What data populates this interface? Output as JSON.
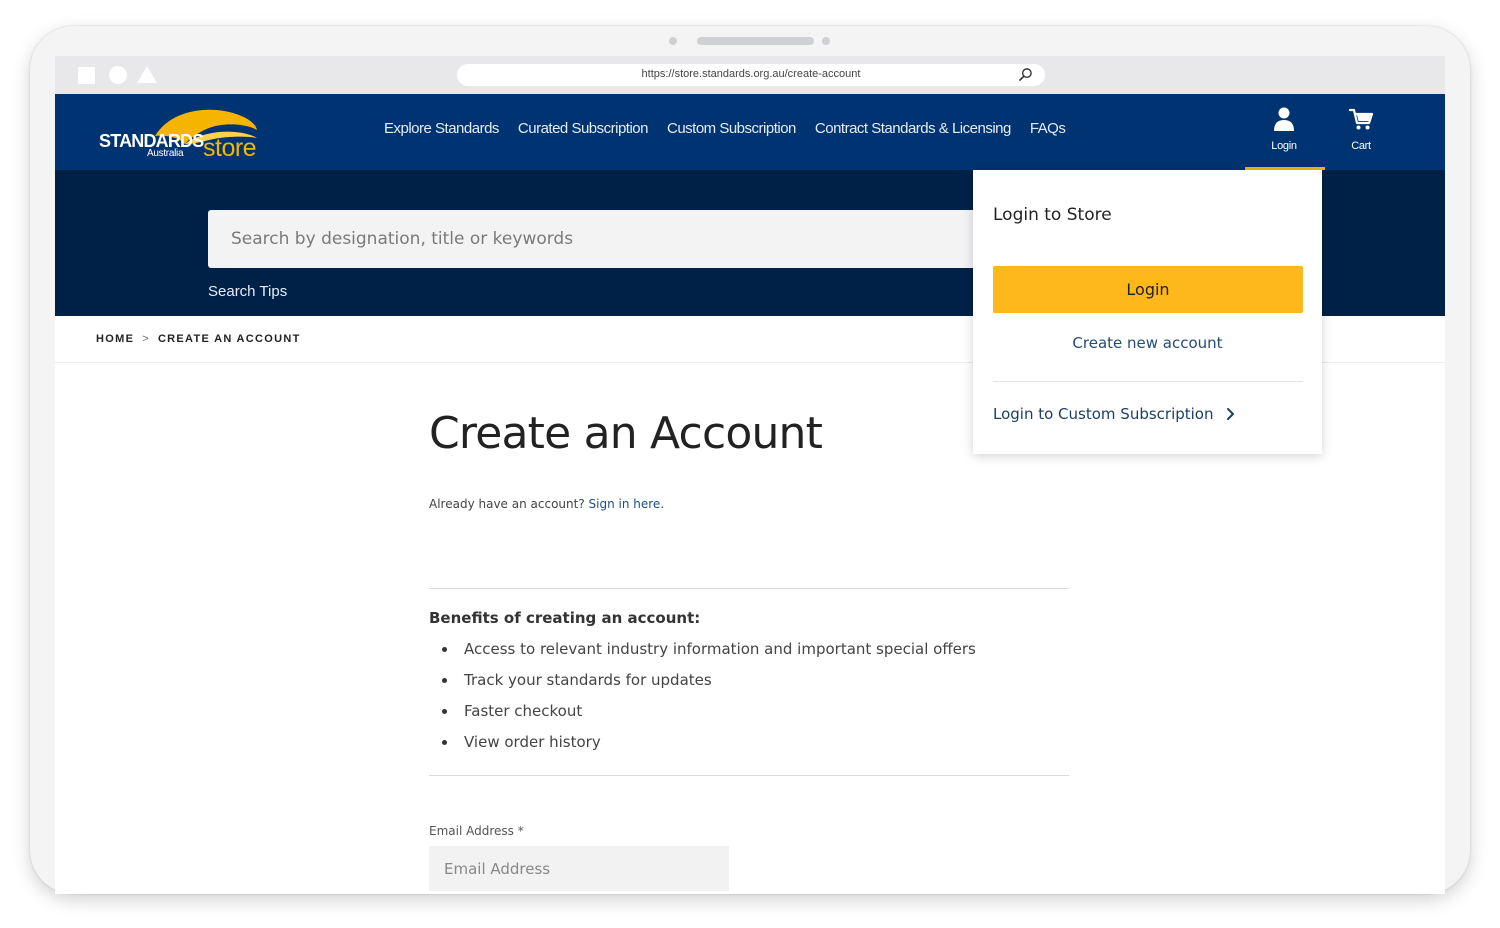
{
  "browser": {
    "url": "https://store.standards.org.au/create-account"
  },
  "brand": {
    "main": "STANDARDS",
    "sub": "Australia",
    "store": "store",
    "accent_color": "#f5b400",
    "nav_color": "#003371",
    "search_band_color": "#002147"
  },
  "nav": {
    "links": [
      "Explore Standards",
      "Curated Subscription",
      "Custom Subscription",
      "Contract Standards & Licensing",
      "FAQs"
    ],
    "login_label": "Login",
    "cart_label": "Cart",
    "login_icon": "user-icon",
    "cart_icon": "cart-icon"
  },
  "search": {
    "placeholder": "Search by designation, title or keywords",
    "tips_label": "Search Tips"
  },
  "breadcrumb": {
    "home": "HOME",
    "separator": ">",
    "current": "CREATE AN ACCOUNT"
  },
  "page": {
    "title": "Create an Account",
    "already_text": "Already have an account?",
    "sign_in_link": "Sign in here.",
    "benefits_title": "Benefits of creating an account:",
    "benefits": [
      "Access to relevant industry information and important special offers",
      "Track your standards for updates",
      "Faster checkout",
      "View order history"
    ],
    "email_label": "Email Address *",
    "email_placeholder": "Email Address"
  },
  "login_dropdown": {
    "title": "Login to Store",
    "login_button": "Login",
    "create_account": "Create new account",
    "custom_subscription": "Login to Custom Subscription",
    "button_color": "#ffb81c"
  }
}
